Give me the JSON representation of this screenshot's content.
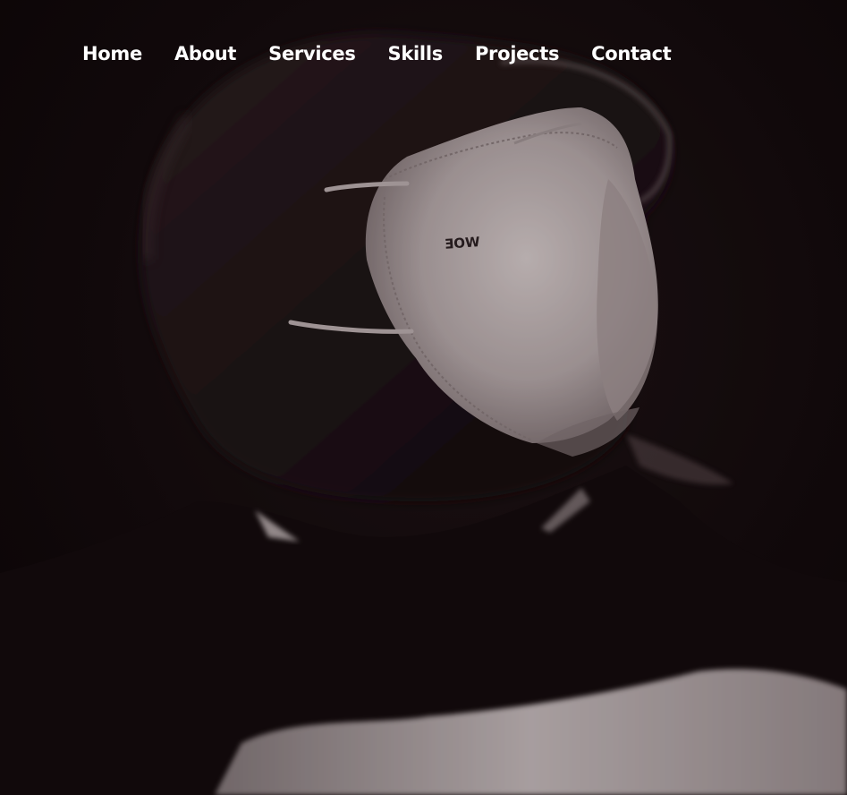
{
  "nav": {
    "items": [
      {
        "label": "Home"
      },
      {
        "label": "About"
      },
      {
        "label": "Services"
      },
      {
        "label": "Skills"
      },
      {
        "label": "Projects"
      },
      {
        "label": "Contact"
      }
    ]
  },
  "hero": {
    "image_subject": "person-wearing-face-mask",
    "mask_print": "ƎOW",
    "colors": {
      "background": "#0f0708",
      "mask": "#b9adad",
      "nav_text": "#ffffff"
    }
  }
}
